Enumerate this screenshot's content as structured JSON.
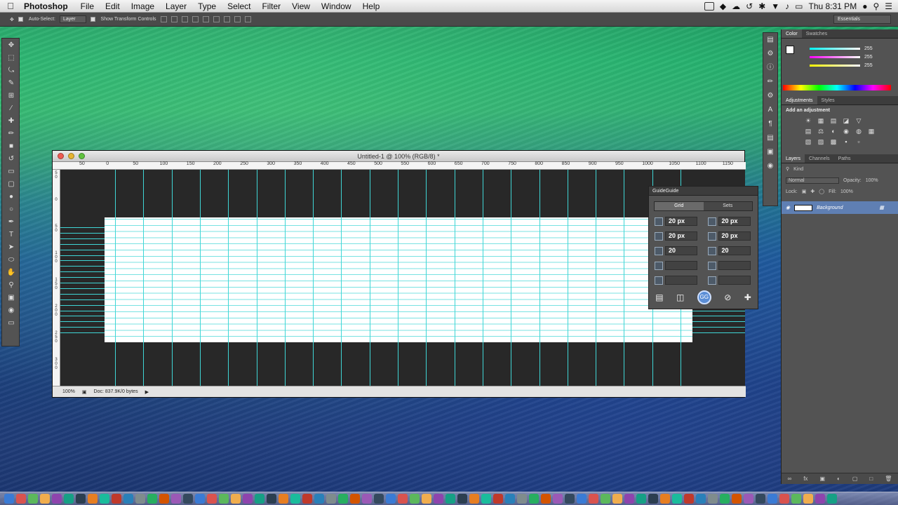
{
  "menubar": {
    "app_name": "Photoshop",
    "menus": [
      "File",
      "Edit",
      "Image",
      "Layer",
      "Type",
      "Select",
      "Filter",
      "View",
      "Window",
      "Help"
    ],
    "clock": "Thu 8:31 PM"
  },
  "options_bar": {
    "auto_select_label": "Auto-Select:",
    "auto_select_value": "Layer",
    "transform_label": "Show Transform Controls",
    "workspace": "Essentials"
  },
  "document": {
    "title": "Untitled-1 @ 100% (RGB/8) *",
    "ruler_h_ticks": [
      "50",
      "0",
      "50",
      "100",
      "150",
      "200",
      "250",
      "300",
      "350",
      "400",
      "450",
      "500",
      "550",
      "600",
      "650",
      "700",
      "750",
      "800",
      "850",
      "900",
      "950",
      "1000",
      "1050",
      "1100",
      "1150"
    ],
    "ruler_v_ticks": [
      "50",
      "0",
      "50",
      "100",
      "150",
      "200",
      "250",
      "300"
    ],
    "zoom": "100%",
    "doc_info": "Doc: 837.9K/0 bytes"
  },
  "guideguide": {
    "title": "GuideGuide",
    "tabs": [
      "Grid",
      "Sets"
    ],
    "active_tab": "Grid",
    "margin_left": "20 px",
    "margin_right": "20 px",
    "margin_top": "20 px",
    "margin_bottom": "20 px",
    "columns": "20",
    "rows": "20",
    "column_width": "",
    "row_height": "",
    "column_gutter": "",
    "row_gutter": "",
    "badge": "GG"
  },
  "panels": {
    "color_tabs": [
      "Color",
      "Swatches"
    ],
    "color_values": {
      "r": "255",
      "g": "255",
      "b": "255"
    },
    "adjust_tabs": [
      "Adjustments",
      "Styles"
    ],
    "adjust_title": "Add an adjustment",
    "layers_tabs": [
      "Layers",
      "Channels",
      "Paths"
    ],
    "kind_label": "Kind",
    "blend_mode": "Normal",
    "opacity_label": "Opacity:",
    "opacity_value": "100%",
    "lock_label": "Lock:",
    "fill_label": "Fill:",
    "fill_value": "100%",
    "layer_name": "Background"
  }
}
